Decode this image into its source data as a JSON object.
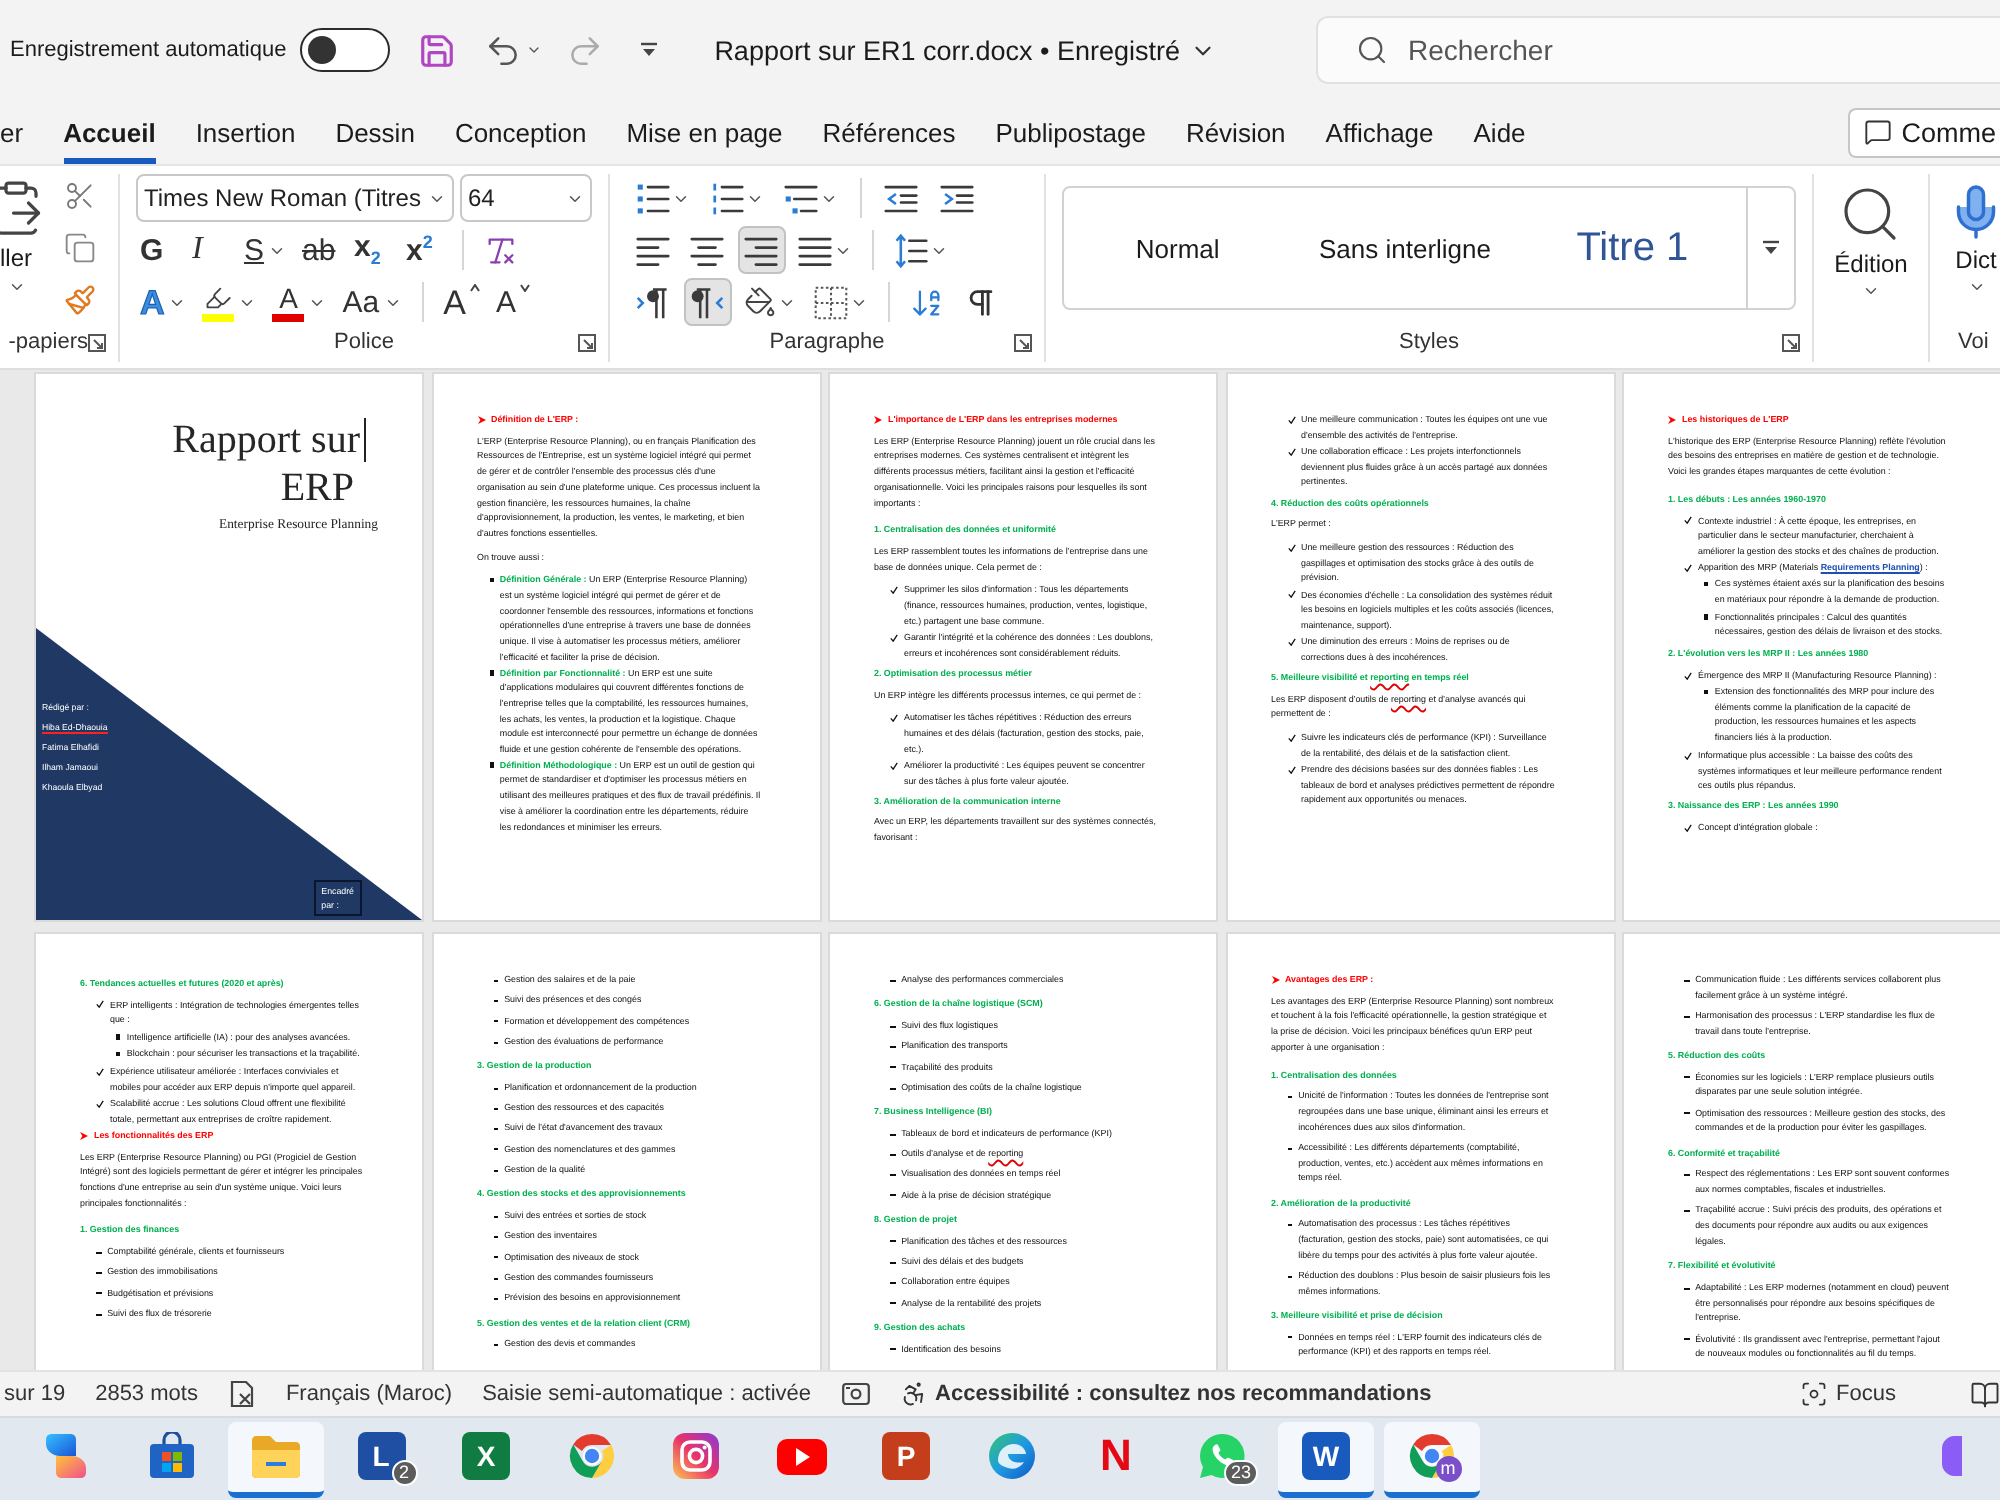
{
  "title_bar": {
    "autosave_label": "Enregistrement automatique",
    "autosave_on": false,
    "undo_enabled": true,
    "redo_enabled": false,
    "document_title": "Rapport sur ER1 corr.docx • Enregistré",
    "search": {
      "placeholder": "Rechercher"
    }
  },
  "tabs": [
    {
      "label": "er",
      "selected": false
    },
    {
      "label": "Accueil",
      "selected": true
    },
    {
      "label": "Insertion",
      "selected": false
    },
    {
      "label": "Dessin",
      "selected": false
    },
    {
      "label": "Conception",
      "selected": false
    },
    {
      "label": "Mise en page",
      "selected": false
    },
    {
      "label": "Références",
      "selected": false
    },
    {
      "label": "Publipostage",
      "selected": false
    },
    {
      "label": "Révision",
      "selected": false
    },
    {
      "label": "Affichage",
      "selected": false
    },
    {
      "label": "Aide",
      "selected": false
    }
  ],
  "comments_button": {
    "label": "Comme"
  },
  "ribbon": {
    "clipboard": {
      "paste_label": "ller",
      "group_label": "-papiers"
    },
    "font": {
      "name": "Times New Roman (Titres",
      "size": "64",
      "row1": [
        {
          "kind": "bold",
          "label": "G",
          "dropdown": false
        },
        {
          "kind": "italic",
          "label": "I",
          "dropdown": false
        },
        {
          "kind": "underline",
          "label": "S",
          "dropdown": true
        },
        {
          "kind": "strike",
          "label": "ab",
          "dropdown": false
        },
        {
          "kind": "subscript",
          "label": "x$_{2}$",
          "dropdown": false
        },
        {
          "kind": "superscript",
          "label": "x$^{2}$",
          "dropdown": false
        },
        {
          "kind": "clear",
          "dropdown": false
        }
      ],
      "row2": [
        {
          "kind": "effects",
          "label": "A",
          "dropdown": true
        },
        {
          "kind": "highlight",
          "color": "#ffff00",
          "dropdown": true
        },
        {
          "kind": "fontcolor",
          "label": "A",
          "color": "#e00000",
          "dropdown": true
        },
        {
          "kind": "case",
          "label": "Aa",
          "dropdown": true
        },
        {
          "kind": "grow",
          "label": "A",
          "dropdown": false
        },
        {
          "kind": "shrink",
          "label": "A",
          "dropdown": false
        }
      ],
      "group_label": "Police"
    },
    "paragraph": {
      "alignment": [
        {
          "kind": "left",
          "selected": false
        },
        {
          "kind": "center",
          "selected": false
        },
        {
          "kind": "right",
          "selected": true
        },
        {
          "kind": "justify",
          "selected": false
        }
      ],
      "direction": [
        {
          "kind": "ltr",
          "selected": false
        },
        {
          "kind": "rtl",
          "selected": true
        }
      ],
      "group_label": "Paragraphe"
    },
    "styles": {
      "items": [
        {
          "label": "Normal",
          "kind": "body"
        },
        {
          "label": "Sans interligne",
          "kind": "body"
        },
        {
          "label": "Titre 1",
          "kind": "heading"
        }
      ],
      "group_label": "Styles"
    },
    "editing": {
      "label": "Édition"
    },
    "voice": {
      "label": "Dict",
      "group_label": "Voi"
    }
  },
  "pages": [
    {
      "kind": "cover",
      "title_lines": [
        "Rapport sur",
        "ERP"
      ],
      "caret": true,
      "subtitle": "Enterprise Resource Planning",
      "authors": [
        {
          "text": "Rédigé par :",
          "misspelled": false
        },
        {
          "text": "Hiba Ed-Dhaouia",
          "misspelled": true
        },
        {
          "text": "Fatima Elhafidi",
          "misspelled": false
        },
        {
          "text": "Ilham Jamaoui",
          "misspelled": false
        },
        {
          "text": "Khaoula Elbyad",
          "misspelled": false
        }
      ],
      "frame_lines": [
        "Encadré",
        "par :"
      ]
    },
    {
      "kind": "text",
      "blocks": [
        {
          "kind": "heading",
          "text": "Définition de L'ERP :"
        },
        {
          "kind": "para",
          "text": "L'ERP (Enterprise Resource Planning), ou en français Planification des Ressources de l'Entreprise, est un système logiciel intégré qui permet de gérer et de contrôler l'ensemble des processus clés d'une organisation au sein d'une plateforme unique. Ces processus incluent la gestion financière, les ressources humaines, la chaîne d'approvisionnement, la production, les ventes, le marketing, et bien d'autres fonctions essentielles."
        },
        {
          "kind": "para",
          "text": "On trouve aussi :"
        },
        {
          "kind": "bullet",
          "parts": [
            {
              "kind": "label",
              "text": "Définition Générale :"
            },
            {
              "kind": "plain",
              "text": " Un ERP (Enterprise Resource Planning) est un système logiciel intégré qui permet de gérer et de coordonner l'ensemble des ressources, informations et fonctions opérationnelles d'une entreprise à travers une base de données unique. Il vise à automatiser les processus métiers, améliorer l'efficacité et faciliter la prise de décision."
            }
          ]
        },
        {
          "kind": "bullet",
          "parts": [
            {
              "kind": "label",
              "text": "Définition par Fonctionnalité :"
            },
            {
              "kind": "plain",
              "text": " Un ERP est une suite d'applications modulaires qui couvrent différentes fonctions de l'entreprise telles que la comptabilité, les ressources humaines, les achats, les ventes, la production et la logistique. Chaque module est interconnecté pour permettre un échange de données fluide et une gestion cohérente de l'ensemble des opérations."
            }
          ]
        },
        {
          "kind": "bullet",
          "parts": [
            {
              "kind": "label",
              "text": "Définition Méthodologique :"
            },
            {
              "kind": "plain",
              "text": " Un ERP est un outil de gestion qui permet de standardiser et d'optimiser les processus métiers en utilisant des meilleures pratiques et des flux de travail prédéfinis. Il vise à améliorer la coordination entre les départements, réduire les redondances et minimiser les erreurs."
            }
          ]
        }
      ]
    },
    {
      "kind": "text",
      "blocks": [
        {
          "kind": "heading",
          "text": "L'importance de L'ERP dans les entreprises modernes"
        },
        {
          "kind": "para",
          "text": "Les ERP (Enterprise Resource Planning) jouent un rôle crucial dans les entreprises modernes. Ces systèmes centralisent et intègrent les différents processus métiers, facilitant ainsi la gestion et l'efficacité organisationnelle. Voici les principales raisons pour lesquelles ils sont importants :"
        },
        {
          "kind": "subheading",
          "text": "1. Centralisation des données et uniformité"
        },
        {
          "kind": "para",
          "text": "Les ERP rassemblent toutes les informations de l'entreprise dans une base de données unique. Cela permet de :"
        },
        {
          "kind": "check",
          "text": "Supprimer les silos d'information : Tous les départements (finance, ressources humaines, production, ventes, logistique, etc.) partagent une base commune."
        },
        {
          "kind": "check",
          "text": "Garantir l'intégrité et la cohérence des données : Les doublons, erreurs et incohérences sont considérablement réduits."
        },
        {
          "kind": "subheading",
          "text": "2. Optimisation des processus métier"
        },
        {
          "kind": "para",
          "text": "Un ERP intègre les différents processus internes, ce qui permet de :"
        },
        {
          "kind": "check",
          "text": "Automatiser les tâches répétitives : Réduction des erreurs humaines et des délais (facturation, gestion des stocks, paie, etc.)."
        },
        {
          "kind": "check",
          "text": "Améliorer la productivité : Les équipes peuvent se concentrer sur des tâches à plus forte valeur ajoutée."
        },
        {
          "kind": "subheading",
          "text": "3. Amélioration de la communication interne"
        },
        {
          "kind": "para",
          "text": "Avec un ERP, les départements travaillent sur des systèmes connectés, favorisant :"
        }
      ]
    },
    {
      "kind": "text",
      "blocks": [
        {
          "kind": "check",
          "text": "Une meilleure communication : Toutes les équipes ont une vue d'ensemble des activités de l'entreprise."
        },
        {
          "kind": "check",
          "text": "Une collaboration efficace : Les projets interfonctionnels deviennent plus fluides grâce à un accès partagé aux données pertinentes."
        },
        {
          "kind": "subheading",
          "text": "4. Réduction des coûts opérationnels"
        },
        {
          "kind": "para",
          "text": "L'ERP permet :"
        },
        {
          "kind": "check",
          "text": "Une meilleure gestion des ressources : Réduction des gaspillages et optimisation des stocks grâce à des outils de prévision."
        },
        {
          "kind": "check",
          "text": "Des économies d'échelle : La consolidation des systèmes réduit les besoins en logiciels multiples et les coûts associés (licences, maintenance, support)."
        },
        {
          "kind": "check",
          "text": "Une diminution des erreurs : Moins de reprises ou de corrections dues à des incohérences."
        },
        {
          "kind": "subheading",
          "parts": [
            {
              "kind": "plain",
              "text": "5. Meilleure visibilité et "
            },
            {
              "kind": "misspelled",
              "text": "reporting"
            },
            {
              "kind": "plain",
              "text": " en temps réel"
            }
          ]
        },
        {
          "kind": "para",
          "parts": [
            {
              "kind": "plain",
              "text": "Les ERP disposent d'outils de "
            },
            {
              "kind": "misspelled",
              "text": "reporting"
            },
            {
              "kind": "plain",
              "text": " et d'analyse avancés qui permettent de :"
            }
          ]
        },
        {
          "kind": "check",
          "text": "Suivre les indicateurs clés de performance (KPI) : Surveillance de la rentabilité, des délais et de la satisfaction client."
        },
        {
          "kind": "check",
          "text": "Prendre des décisions basées sur des données fiables : Les tableaux de bord et analyses prédictives permettent de répondre rapidement aux opportunités ou menaces."
        }
      ]
    },
    {
      "kind": "text",
      "blocks": [
        {
          "kind": "heading",
          "text": "Les historiques de L'ERP"
        },
        {
          "kind": "para",
          "text": "L'historique des ERP (Enterprise Resource Planning) reflète l'évolution des besoins des entreprises en matière de gestion et de technologie. Voici les grandes étapes marquantes de cette évolution :"
        },
        {
          "kind": "subheading",
          "text": "1. Les débuts : Les années 1960-1970"
        },
        {
          "kind": "check",
          "text": "Contexte industriel : À cette époque, les entreprises, en particulier dans le secteur manufacturier, cherchaient à améliorer la gestion des stocks et des chaînes de production."
        },
        {
          "kind": "check",
          "parts": [
            {
              "kind": "plain",
              "text": "Apparition des MRP (Materials "
            },
            {
              "kind": "link",
              "text": "Requirements Planning"
            },
            {
              "kind": "plain",
              "text": ") :"
            }
          ]
        },
        {
          "kind": "sub",
          "text": "Ces systèmes étaient axés sur la planification des besoins en matériaux pour répondre à la demande de production."
        },
        {
          "kind": "sub",
          "text": "Fonctionnalités principales : Calcul des quantités nécessaires, gestion des délais de livraison et des stocks."
        },
        {
          "kind": "subheading",
          "text": "2. L'évolution vers les MRP II : Les années 1980"
        },
        {
          "kind": "check",
          "text": "Émergence des MRP II (Manufacturing Resource Planning) :"
        },
        {
          "kind": "sub",
          "text": "Extension des fonctionnalités des MRP pour inclure des éléments comme la planification de la capacité de production, les ressources humaines et les aspects financiers liés à la production."
        },
        {
          "kind": "check",
          "text": "Informatique plus accessible : La baisse des coûts des systèmes informatiques et leur meilleure performance rendent ces outils plus répandus."
        },
        {
          "kind": "subheading",
          "text": "3. Naissance des ERP : Les années 1990"
        },
        {
          "kind": "check",
          "text": "Concept d'intégration globale :"
        }
      ]
    },
    {
      "kind": "text",
      "blocks": [
        {
          "kind": "subheading",
          "text": "6. Tendances actuelles et futures (2020 et après)"
        },
        {
          "kind": "check",
          "text": "ERP intelligents : Intégration de technologies émergentes telles que :"
        },
        {
          "kind": "sub",
          "text": "Intelligence artificielle (IA) : pour des analyses avancées."
        },
        {
          "kind": "sub",
          "text": "Blockchain : pour sécuriser les transactions et la traçabilité."
        },
        {
          "kind": "check",
          "text": "Expérience utilisateur améliorée : Interfaces conviviales et mobiles pour accéder aux ERP depuis n'importe quel appareil."
        },
        {
          "kind": "check",
          "text": "Scalabilité accrue : Les solutions Cloud offrent une flexibilité totale, permettant aux entreprises de croître rapidement."
        },
        {
          "kind": "heading",
          "text": "Les fonctionnalités des ERP"
        },
        {
          "kind": "para",
          "text": "Les ERP (Enterprise Resource Planning) ou PGI (Progiciel de Gestion Intégré) sont des logiciels permettant de gérer et intégrer les principales fonctions d'une entreprise au sein d'un système unique. Voici leurs principales fonctionnalités :"
        },
        {
          "kind": "subheading",
          "text": "1. Gestion des finances"
        },
        {
          "kind": "dash",
          "text": "Comptabilité générale, clients et fournisseurs"
        },
        {
          "kind": "dash",
          "text": "Gestion des immobilisations"
        },
        {
          "kind": "dash",
          "text": "Budgétisation et prévisions"
        },
        {
          "kind": "dash",
          "text": "Suivi des flux de trésorerie"
        }
      ]
    },
    {
      "kind": "text",
      "blocks": [
        {
          "kind": "dash",
          "text": "Gestion des salaires et de la paie"
        },
        {
          "kind": "dash",
          "text": "Suivi des présences et des congés"
        },
        {
          "kind": "dash",
          "text": "Formation et développement des compétences"
        },
        {
          "kind": "dash",
          "text": "Gestion des évaluations de performance"
        },
        {
          "kind": "subheading",
          "text": "3. Gestion de la production"
        },
        {
          "kind": "dash",
          "text": "Planification et ordonnancement de la production"
        },
        {
          "kind": "dash",
          "text": "Gestion des ressources et des capacités"
        },
        {
          "kind": "dash",
          "text": "Suivi de l'état d'avancement des travaux"
        },
        {
          "kind": "dash",
          "text": "Gestion des nomenclatures et des gammes"
        },
        {
          "kind": "dash",
          "text": "Gestion de la qualité"
        },
        {
          "kind": "subheading",
          "text": "4. Gestion des stocks et des approvisionnements"
        },
        {
          "kind": "dash",
          "text": "Suivi des entrées et sorties de stock"
        },
        {
          "kind": "dash",
          "text": "Gestion des inventaires"
        },
        {
          "kind": "dash",
          "text": "Optimisation des niveaux de stock"
        },
        {
          "kind": "dash",
          "text": "Gestion des commandes fournisseurs"
        },
        {
          "kind": "dash",
          "text": "Prévision des besoins en approvisionnement"
        },
        {
          "kind": "subheading",
          "text": "5. Gestion des ventes et de la relation client (CRM)"
        },
        {
          "kind": "dash",
          "text": "Gestion des devis et commandes"
        }
      ]
    },
    {
      "kind": "text",
      "blocks": [
        {
          "kind": "dash",
          "text": "Analyse des performances commerciales"
        },
        {
          "kind": "subheading",
          "text": "6. Gestion de la chaîne logistique (SCM)"
        },
        {
          "kind": "dash",
          "text": "Suivi des flux logistiques"
        },
        {
          "kind": "dash",
          "text": "Planification des transports"
        },
        {
          "kind": "dash",
          "text": "Traçabilité des produits"
        },
        {
          "kind": "dash",
          "text": "Optimisation des coûts de la chaîne logistique"
        },
        {
          "kind": "subheading",
          "text": "7. Business Intelligence (BI)"
        },
        {
          "kind": "dash",
          "text": "Tableaux de bord et indicateurs de performance (KPI)"
        },
        {
          "kind": "dash",
          "parts": [
            {
              "kind": "plain",
              "text": "Outils d'analyse et de "
            },
            {
              "kind": "misspelled",
              "text": "reporting"
            }
          ]
        },
        {
          "kind": "dash",
          "text": "Visualisation des données en temps réel"
        },
        {
          "kind": "dash",
          "text": "Aide à la prise de décision stratégique"
        },
        {
          "kind": "subheading",
          "text": "8. Gestion de projet"
        },
        {
          "kind": "dash",
          "text": "Planification des tâches et des ressources"
        },
        {
          "kind": "dash",
          "text": "Suivi des délais et des budgets"
        },
        {
          "kind": "dash",
          "text": "Collaboration entre équipes"
        },
        {
          "kind": "dash",
          "text": "Analyse de la rentabilité des projets"
        },
        {
          "kind": "subheading",
          "text": "9. Gestion des achats"
        },
        {
          "kind": "dash",
          "text": "Identification des besoins"
        }
      ]
    },
    {
      "kind": "text",
      "blocks": [
        {
          "kind": "heading",
          "text": "Avantages des ERP :"
        },
        {
          "kind": "para",
          "text": "Les avantages des ERP (Enterprise Resource Planning) sont nombreux et touchent à la fois l'efficacité opérationnelle, la gestion stratégique et la prise de décision. Voici les principaux bénéfices qu'un ERP peut apporter à une organisation :"
        },
        {
          "kind": "subheading",
          "text": "1. Centralisation des données"
        },
        {
          "kind": "dash",
          "text": "Unicité de l'information : Toutes les données de l'entreprise sont regroupées dans une base unique, éliminant ainsi les erreurs et incohérences dues aux silos d'information."
        },
        {
          "kind": "dash",
          "text": "Accessibilité : Les différents départements (comptabilité, production, ventes, etc.) accèdent aux mêmes informations en temps réel."
        },
        {
          "kind": "subheading",
          "text": "2. Amélioration de la productivité"
        },
        {
          "kind": "dash",
          "text": "Automatisation des processus : Les tâches répétitives (facturation, gestion des stocks, paie) sont automatisées, ce qui libère du temps pour des activités à plus forte valeur ajoutée."
        },
        {
          "kind": "dash",
          "text": "Réduction des doublons : Plus besoin de saisir plusieurs fois les mêmes informations."
        },
        {
          "kind": "subheading",
          "text": "3. Meilleure visibilité et prise de décision"
        },
        {
          "kind": "dash",
          "text": "Données en temps réel : L'ERP fournit des indicateurs clés de performance (KPI) et des rapports en temps réel."
        }
      ]
    },
    {
      "kind": "text",
      "blocks": [
        {
          "kind": "dash",
          "text": "Communication fluide : Les différents services collaborent plus facilement grâce à un système intégré."
        },
        {
          "kind": "dash",
          "text": "Harmonisation des processus : L'ERP standardise les flux de travail dans toute l'entreprise."
        },
        {
          "kind": "subheading",
          "text": "5. Réduction des coûts"
        },
        {
          "kind": "dash",
          "text": "Économies sur les logiciels : L'ERP remplace plusieurs outils disparates par une seule solution intégrée."
        },
        {
          "kind": "dash",
          "text": "Optimisation des ressources : Meilleure gestion des stocks, des commandes et de la production pour éviter les gaspillages."
        },
        {
          "kind": "subheading",
          "text": "6. Conformité et traçabilité"
        },
        {
          "kind": "dash",
          "text": "Respect des réglementations : Les ERP sont souvent conformes aux normes comptables, fiscales et industrielles."
        },
        {
          "kind": "dash",
          "text": "Traçabilité accrue : Suivi précis des produits, des opérations et des documents pour répondre aux audits ou aux exigences légales."
        },
        {
          "kind": "subheading",
          "text": "7. Flexibilité et évolutivité"
        },
        {
          "kind": "dash",
          "text": "Adaptabilité : Les ERP modernes (notamment en cloud) peuvent être personnalisés pour répondre aux besoins spécifiques de l'entreprise."
        },
        {
          "kind": "dash",
          "text": "Évolutivité : Ils grandissent avec l'entreprise, permettant l'ajout de nouveaux modules ou fonctionnalités au fil du temps."
        }
      ]
    }
  ],
  "status_bar": {
    "page": "sur 19",
    "words": "2853 mots",
    "language": "Français (Maroc)",
    "autocomplete": "Saisie semi-automatique : activée",
    "accessibility": "Accessibilité : consultez nos recommandations",
    "focus": "Focus"
  },
  "taskbar": [
    {
      "kind": "swirl",
      "active": false
    },
    {
      "kind": "store",
      "active": false
    },
    {
      "kind": "folder",
      "active": true
    },
    {
      "kind": "tile",
      "letter": "L",
      "color": "#1e4fa3",
      "badge": "2",
      "active": false
    },
    {
      "kind": "tile",
      "letter": "X",
      "color": "#107c41",
      "active": false
    },
    {
      "kind": "browser",
      "active": false
    },
    {
      "kind": "camera",
      "active": false
    },
    {
      "kind": "video",
      "active": false
    },
    {
      "kind": "tile",
      "letter": "P",
      "color": "#c43e1c",
      "active": false
    },
    {
      "kind": "wave",
      "active": false
    },
    {
      "kind": "glyph",
      "letter": "N",
      "color": "#e50914",
      "active": false
    },
    {
      "kind": "chat",
      "badge": "23",
      "active": false
    },
    {
      "kind": "tile",
      "letter": "W",
      "color": "#185abd",
      "active": true
    },
    {
      "kind": "profile",
      "letter": "m",
      "active": true
    },
    {
      "kind": "partial",
      "active": false
    }
  ]
}
